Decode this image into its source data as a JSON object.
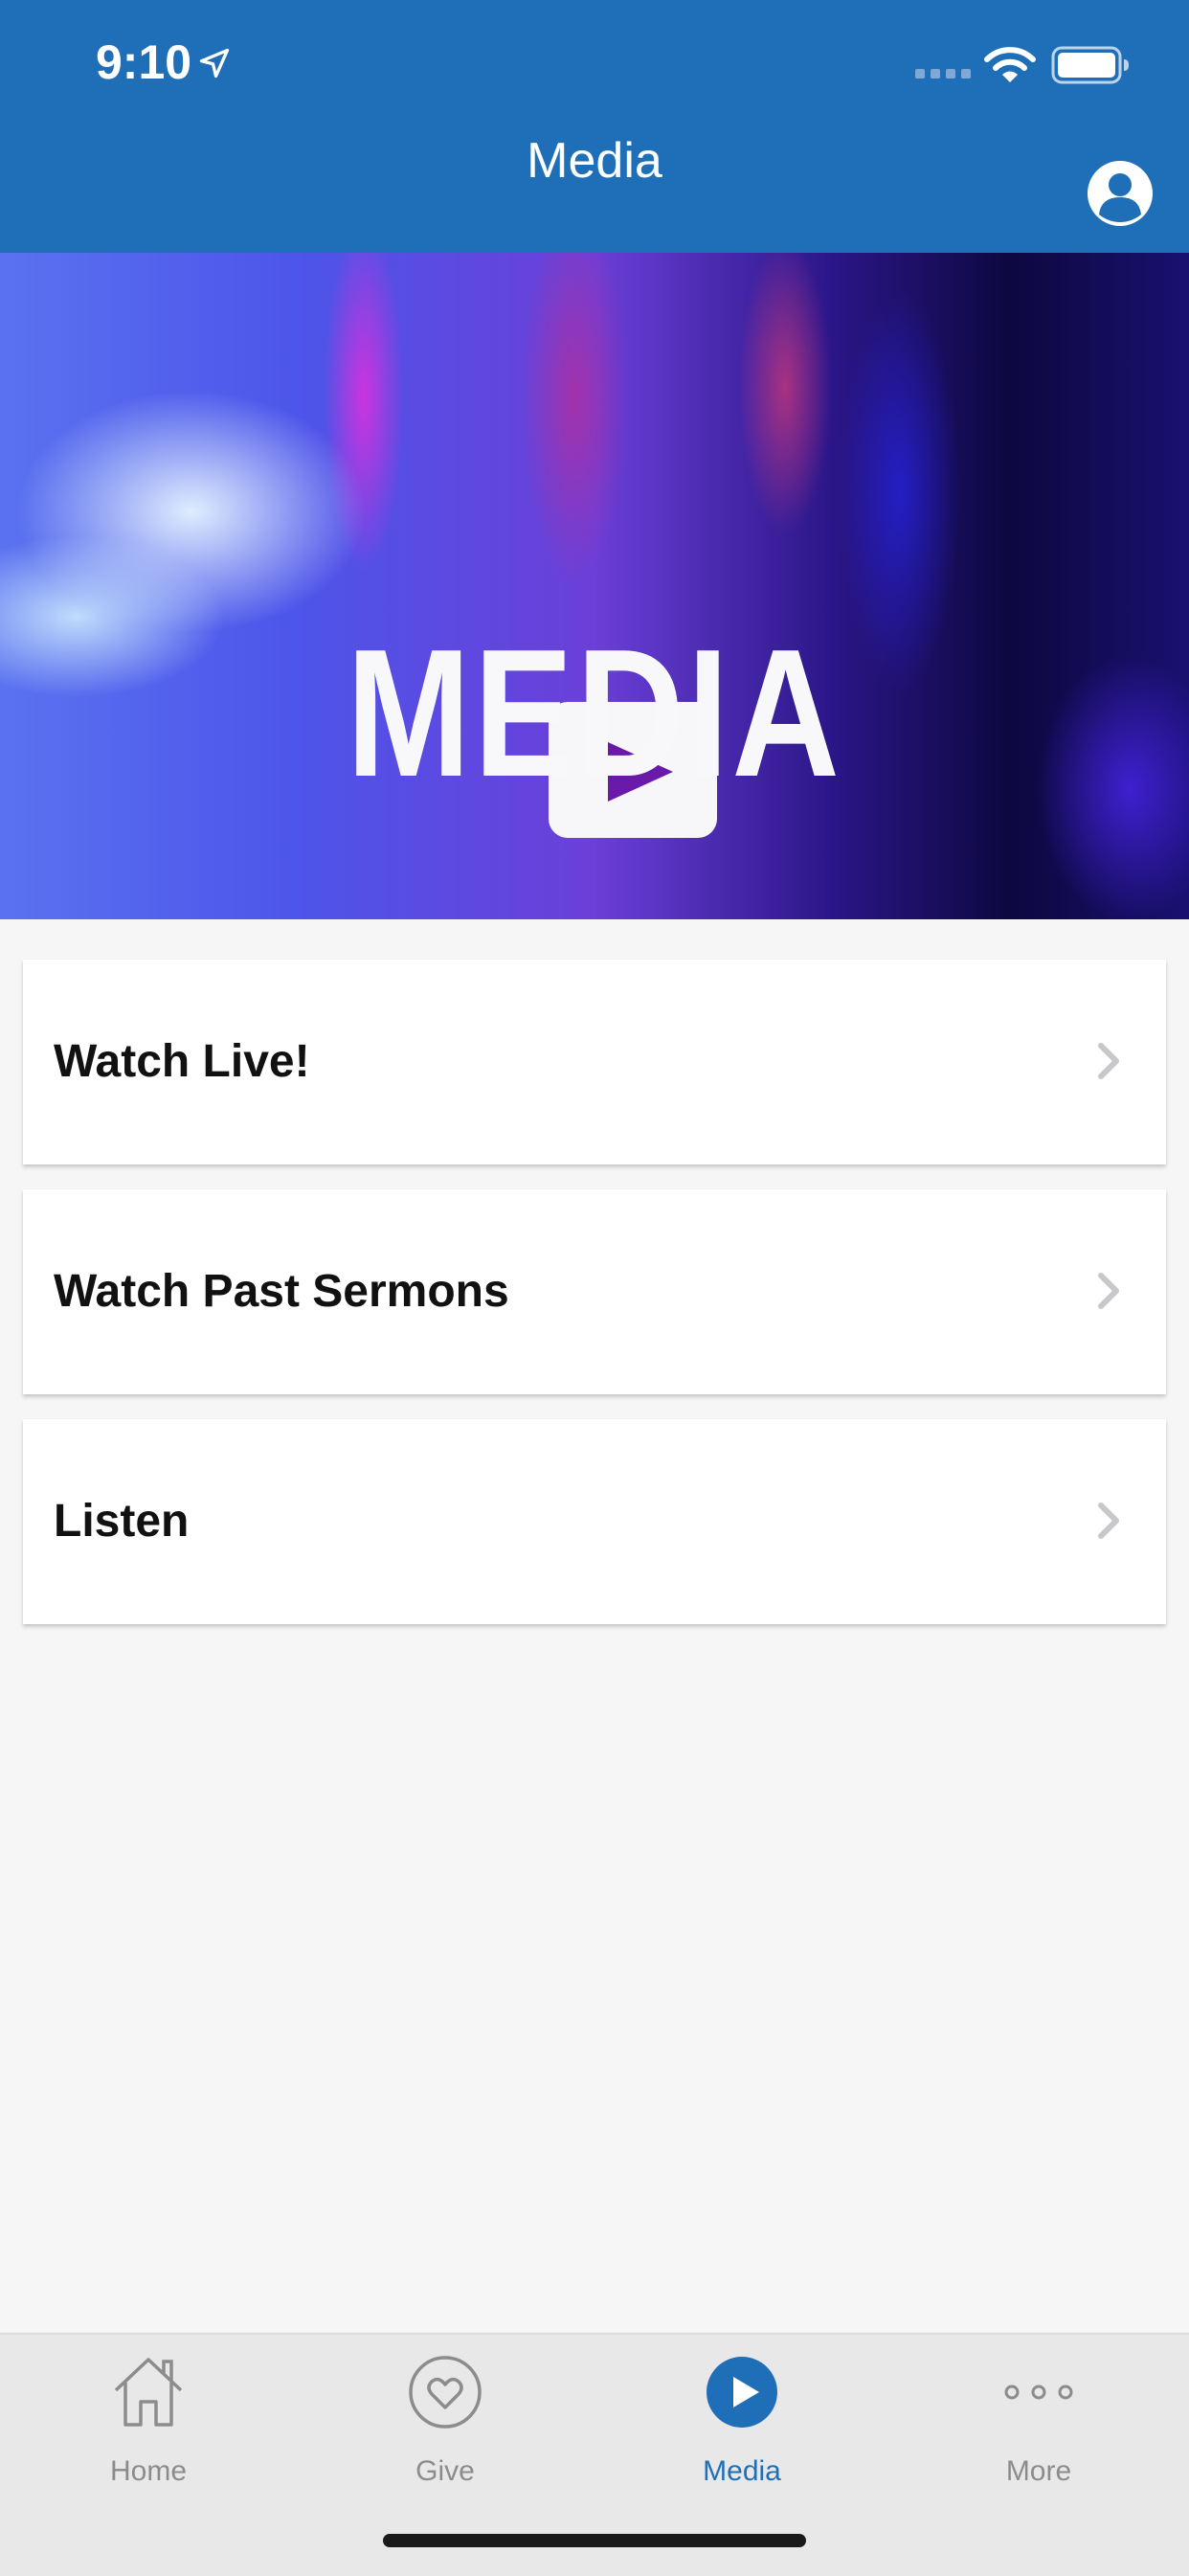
{
  "status_bar": {
    "time": "9:10",
    "icons": [
      "location-arrow-icon",
      "signal-icon",
      "wifi-icon",
      "battery-icon"
    ]
  },
  "nav": {
    "title": "Media",
    "right_icon": "profile-icon"
  },
  "hero": {
    "text": "MEDIA",
    "icon": "play-icon"
  },
  "menu": {
    "items": [
      {
        "label": "Watch Live!",
        "icon": "chevron-right-icon"
      },
      {
        "label": "Watch Past Sermons",
        "icon": "chevron-right-icon"
      },
      {
        "label": "Listen",
        "icon": "chevron-right-icon"
      }
    ]
  },
  "tabbar": {
    "tabs": [
      {
        "label": "Home",
        "icon": "home-icon",
        "active": false
      },
      {
        "label": "Give",
        "icon": "heart-icon",
        "active": false
      },
      {
        "label": "Media",
        "icon": "play-icon",
        "active": true
      },
      {
        "label": "More",
        "icon": "more-icon",
        "active": false
      }
    ]
  },
  "colors": {
    "brand": "#1f6fb8",
    "inactive_tab": "#8c8c8c",
    "background": "#f6f6f6"
  }
}
